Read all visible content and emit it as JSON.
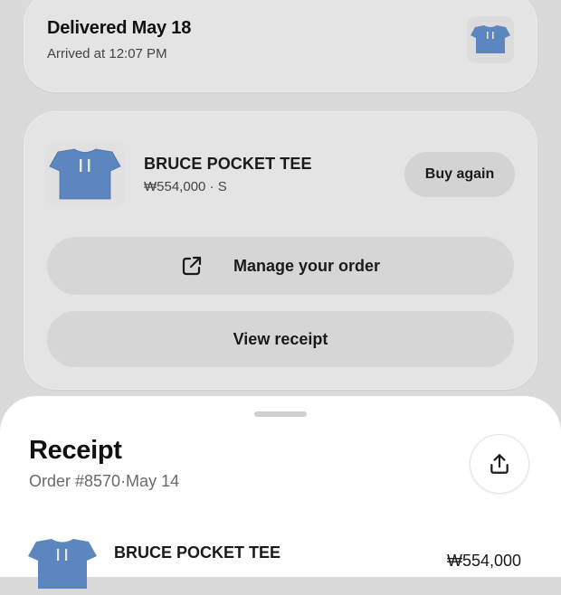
{
  "delivery": {
    "title": "Delivered May 18",
    "subtitle": "Arrived at 12:07 PM"
  },
  "product": {
    "name": "BRUCE POCKET TEE",
    "price": "₩554,000 · S",
    "buy_again_label": "Buy again",
    "image_icon": "tshirt-icon"
  },
  "actions": {
    "manage_label": "Manage your order",
    "manage_icon": "external-link-icon",
    "receipt_label": "View receipt"
  },
  "receipt": {
    "title": "Receipt",
    "order_info": "Order #8570·May 14",
    "share_icon": "share-icon",
    "line_item": {
      "name": "BRUCE POCKET TEE",
      "price": "₩554,000"
    }
  },
  "colors": {
    "background": "#dadada",
    "card": "#e4e4e4",
    "button": "#d6d6d6",
    "sheet": "#ffffff",
    "tee_blue": "#5b86c0"
  }
}
